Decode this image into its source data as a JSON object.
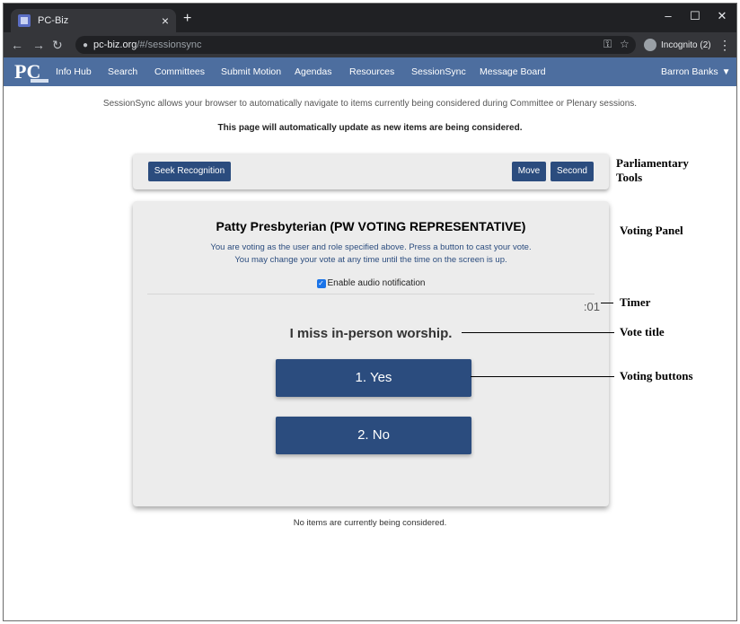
{
  "browser": {
    "tab_title": "PC-Biz",
    "tab_close": "×",
    "new_tab": "+",
    "window_controls": {
      "minimize": "–",
      "maximize": "☐",
      "close": "✕"
    },
    "url_host": "pc-biz.org",
    "url_path": "/#/sessionsync",
    "incognito_label": "Incognito (2)",
    "icons": [
      "back-icon",
      "forward-icon",
      "reload-icon",
      "lock-icon",
      "key-icon",
      "star-icon",
      "incognito-icon",
      "menu-icon"
    ]
  },
  "site": {
    "logo": "PC",
    "nav": [
      "Info Hub",
      "Search",
      "Committees",
      "Submit Motion",
      "Agendas",
      "Resources",
      "SessionSync",
      "Message Board"
    ],
    "user": "Barron Banks",
    "colors": {
      "nav_bg": "#4d6e9f",
      "button": "#2b4c7e",
      "panel": "#ececec"
    }
  },
  "intro": "SessionSync allows your browser to automatically navigate to items currently being considered during Committee or Plenary sessions.",
  "autoupdate": "This page will automatically update as new items are being considered.",
  "tools": {
    "seek_recognition": "Seek Recognition",
    "move": "Move",
    "second": "Second"
  },
  "voting": {
    "voter": "Patty Presbyterian (PW VOTING REPRESENTATIVE)",
    "instruction_1": "You are voting as the user and role specified above. Press a button to cast your vote.",
    "instruction_2": "You may change your vote at any time until the time on the screen is up.",
    "audio_label": "Enable audio notification",
    "audio_checked": true,
    "timer": ":01",
    "title": "I miss in-person worship.",
    "options": [
      "1. Yes",
      "2. No"
    ]
  },
  "no_items": "No items are currently being considered.",
  "annotations": {
    "tools": "Parliamentary Tools",
    "panel": "Voting Panel",
    "timer": "Timer",
    "vote_title": "Vote title",
    "buttons": "Voting buttons"
  }
}
